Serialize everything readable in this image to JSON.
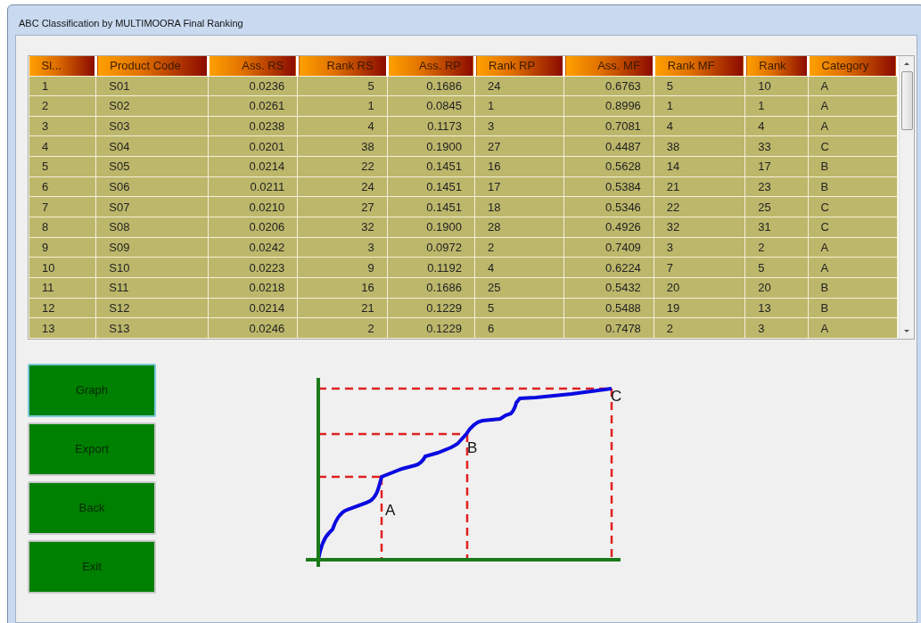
{
  "window": {
    "title": "ABC Classification by MULTIMOORA Final Ranking"
  },
  "table": {
    "columns": [
      {
        "label": "Sl...",
        "right_aligned": false
      },
      {
        "label": "Product Code",
        "right_aligned": false
      },
      {
        "label": "Ass. RS",
        "right_aligned": true
      },
      {
        "label": "Rank RS",
        "right_aligned": true
      },
      {
        "label": "Ass. RP",
        "right_aligned": true
      },
      {
        "label": "Rank RP",
        "right_aligned": false
      },
      {
        "label": "Ass. MF",
        "right_aligned": true
      },
      {
        "label": "Rank MF",
        "right_aligned": false
      },
      {
        "label": "Rank",
        "right_aligned": false
      },
      {
        "label": "Category",
        "right_aligned": false
      }
    ],
    "rows": [
      [
        "1",
        "S01",
        "0.0236",
        "5",
        "0.1686",
        "24",
        "0.6763",
        "5",
        "10",
        "A"
      ],
      [
        "2",
        "S02",
        "0.0261",
        "1",
        "0.0845",
        "1",
        "0.8996",
        "1",
        "1",
        "A"
      ],
      [
        "3",
        "S03",
        "0.0238",
        "4",
        "0.1173",
        "3",
        "0.7081",
        "4",
        "4",
        "A"
      ],
      [
        "4",
        "S04",
        "0.0201",
        "38",
        "0.1900",
        "27",
        "0.4487",
        "38",
        "33",
        "C"
      ],
      [
        "5",
        "S05",
        "0.0214",
        "22",
        "0.1451",
        "16",
        "0.5628",
        "14",
        "17",
        "B"
      ],
      [
        "6",
        "S06",
        "0.0211",
        "24",
        "0.1451",
        "17",
        "0.5384",
        "21",
        "23",
        "B"
      ],
      [
        "7",
        "S07",
        "0.0210",
        "27",
        "0.1451",
        "18",
        "0.5346",
        "22",
        "25",
        "C"
      ],
      [
        "8",
        "S08",
        "0.0206",
        "32",
        "0.1900",
        "28",
        "0.4926",
        "32",
        "31",
        "C"
      ],
      [
        "9",
        "S09",
        "0.0242",
        "3",
        "0.0972",
        "2",
        "0.7409",
        "3",
        "2",
        "A"
      ],
      [
        "10",
        "S10",
        "0.0223",
        "9",
        "0.1192",
        "4",
        "0.6224",
        "7",
        "5",
        "A"
      ],
      [
        "11",
        "S11",
        "0.0218",
        "16",
        "0.1686",
        "25",
        "0.5432",
        "20",
        "20",
        "B"
      ],
      [
        "12",
        "S12",
        "0.0214",
        "21",
        "0.1229",
        "5",
        "0.5488",
        "19",
        "13",
        "B"
      ],
      [
        "13",
        "S13",
        "0.0246",
        "2",
        "0.1229",
        "6",
        "0.7478",
        "2",
        "3",
        "A"
      ]
    ]
  },
  "buttons": [
    {
      "label": "Graph",
      "focused": true
    },
    {
      "label": "Export",
      "focused": false
    },
    {
      "label": "Back",
      "focused": false
    },
    {
      "label": "Exit",
      "focused": false
    }
  ],
  "graph": {
    "point_labels": [
      "A",
      "B",
      "C"
    ]
  }
}
